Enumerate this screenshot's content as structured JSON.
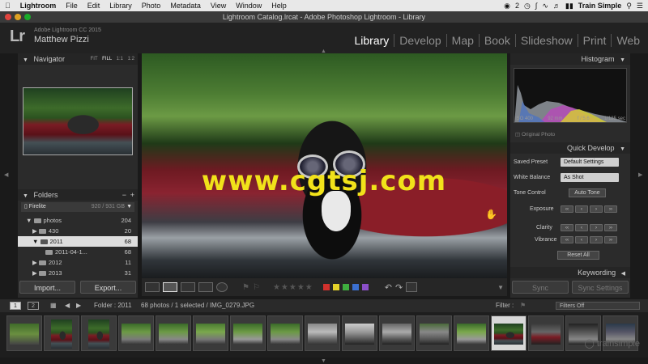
{
  "menubar": {
    "apple": "",
    "items": [
      "Lightroom",
      "File",
      "Edit",
      "Library",
      "Photo",
      "Metadata",
      "View",
      "Window",
      "Help"
    ],
    "right_badge": "2",
    "right_user": "Train Simple"
  },
  "window": {
    "title": "Lightroom Catalog.lrcat - Adobe Photoshop Lightroom - Library"
  },
  "identity": {
    "logo": "Lr",
    "version": "Adobe Lightroom CC 2015",
    "user": "Matthew Pizzi"
  },
  "modules": [
    "Library",
    "Develop",
    "Map",
    "Book",
    "Slideshow",
    "Print",
    "Web"
  ],
  "active_module": "Library",
  "navigator": {
    "title": "Navigator",
    "options": [
      "FIT",
      "FILL",
      "1:1",
      "1:2"
    ],
    "selected_option": "FILL"
  },
  "folders": {
    "title": "Folders",
    "volume": {
      "name": "Firelite",
      "size": "920 / 931 GB"
    },
    "rows": [
      {
        "name": "photos",
        "count": "204"
      },
      {
        "name": "430",
        "count": "20"
      },
      {
        "name": "2011",
        "count": "68"
      },
      {
        "name": "2011-04-1...",
        "count": "68"
      },
      {
        "name": "2012",
        "count": "11"
      },
      {
        "name": "2013",
        "count": "31"
      }
    ]
  },
  "left_buttons": {
    "import": "Import...",
    "export": "Export..."
  },
  "watermark": "www.cgtsj.com",
  "histogram": {
    "title": "Histogram",
    "iso": "ISO 400",
    "focal": "92 mm",
    "aperture": "f / 5.6",
    "shutter": "1/125 sec",
    "original_photo": "Original Photo"
  },
  "quick_develop": {
    "title": "Quick Develop",
    "saved_preset_label": "Saved Preset",
    "saved_preset_value": "Default Settings",
    "white_balance_label": "White Balance",
    "white_balance_value": "As Shot",
    "tone_control_label": "Tone Control",
    "auto_tone": "Auto Tone",
    "exposure": "Exposure",
    "clarity": "Clarity",
    "vibrance": "Vibrance",
    "reset_all": "Reset All"
  },
  "keywording": {
    "title": "Keywording"
  },
  "right_buttons": {
    "sync": "Sync",
    "sync_settings": "Sync Settings"
  },
  "filmstrip_bar": {
    "screen1": "1",
    "screen2": "2",
    "folder": "Folder : 2011",
    "info": "68 photos / 1 selected / IMG_0279.JPG",
    "filter_label": "Filter :",
    "filter_value": "Filters Off"
  },
  "watermark_brand": "trainsimple",
  "colors": {
    "accent_active": "#ffffff",
    "label_red": "#d0312d",
    "label_yellow": "#e4d22a",
    "label_green": "#3fae3f",
    "label_blue": "#3b6fd0",
    "label_purple": "#8a4fc8",
    "watermark": "#f1e21a"
  }
}
